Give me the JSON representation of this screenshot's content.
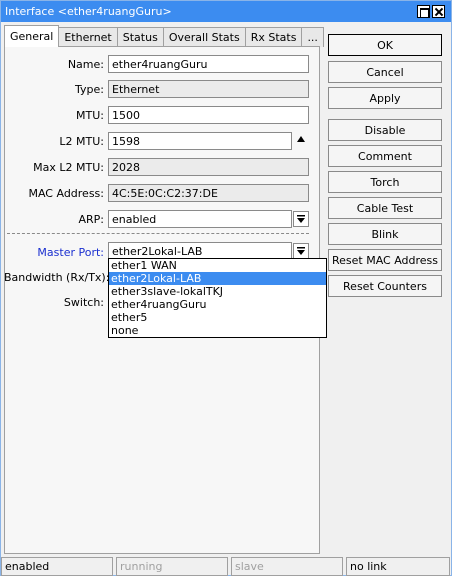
{
  "window": {
    "title": "Interface <ether4ruangGuru>"
  },
  "tabs": [
    {
      "label": "General"
    },
    {
      "label": "Ethernet"
    },
    {
      "label": "Status"
    },
    {
      "label": "Overall Stats"
    },
    {
      "label": "Rx Stats"
    },
    {
      "label": "..."
    }
  ],
  "general": {
    "name": {
      "label": "Name:",
      "value": "ether4ruangGuru"
    },
    "type": {
      "label": "Type:",
      "value": "Ethernet"
    },
    "mtu": {
      "label": "MTU:",
      "value": "1500"
    },
    "l2mtu": {
      "label": "L2 MTU:",
      "value": "1598"
    },
    "max_l2mtu": {
      "label": "Max L2 MTU:",
      "value": "2028"
    },
    "mac": {
      "label": "MAC Address:",
      "value": "4C:5E:0C:C2:37:DE"
    },
    "arp": {
      "label": "ARP:",
      "value": "enabled"
    },
    "master_port": {
      "label": "Master Port:",
      "value": "ether2Lokal-LAB"
    },
    "bandwidth": {
      "label": "Bandwidth (Rx/Tx):"
    },
    "switch": {
      "label": "Switch:"
    }
  },
  "master_port_options": [
    "ether1 WAN",
    "ether2Lokal-LAB",
    "ether3slave-lokalTKJ",
    "ether4ruangGuru",
    "ether5",
    "none"
  ],
  "buttons": {
    "ok": "OK",
    "cancel": "Cancel",
    "apply": "Apply",
    "disable": "Disable",
    "comment": "Comment",
    "torch": "Torch",
    "cable_test": "Cable Test",
    "blink": "Blink",
    "reset_mac": "Reset MAC Address",
    "reset_counters": "Reset Counters"
  },
  "status": {
    "enabled": "enabled",
    "running": "running",
    "slave": "slave",
    "link": "no link"
  },
  "colors": {
    "titlebar": "#3c8cf0",
    "selection": "#3c8cf0",
    "master_label": "#1a2fd0"
  }
}
